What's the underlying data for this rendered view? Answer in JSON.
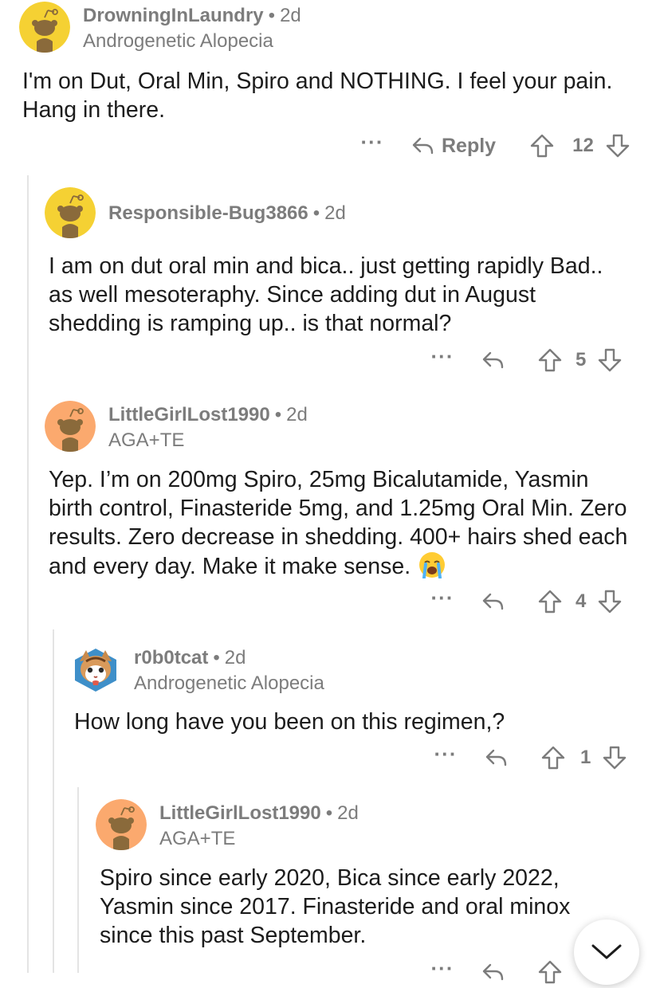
{
  "comments": [
    {
      "username": "DrowningInLaundry",
      "age": "2d",
      "flair": "Androgenetic Alopecia",
      "body": "I'm on Dut, Oral Min, Spiro and NOTHING. I feel your pain.  Hang in there.",
      "reply_label": "Reply",
      "score": "12",
      "avatar_color": "#f5d133"
    },
    {
      "username": "Responsible-Bug3866",
      "age": "2d",
      "body": "I am on dut oral min and bica.. just getting rapidly Bad.. as well mesoteraphy. Since adding dut in August shedding is ramping up.. is that normal?",
      "score": "5",
      "avatar_color": "#f5d133"
    },
    {
      "username": "LittleGirlLost1990",
      "age": "2d",
      "flair": "AGA+TE",
      "body": "Yep. I’m on 200mg Spiro, 25mg Bicalutamide, Yasmin birth control, Finasteride 5mg, and 1.25mg Oral Min. Zero results. Zero decrease in shedding. 400+ hairs shed each and every day. Make it make sense.",
      "score": "4",
      "avatar_color": "#fba96e"
    },
    {
      "username": "r0b0tcat",
      "age": "2d",
      "flair": "Androgenetic Alopecia",
      "body": "How long have you been on this regimen,?",
      "score": "1"
    },
    {
      "username": "LittleGirlLost1990",
      "age": "2d",
      "flair": "AGA+TE",
      "body": "Spiro since early 2020, Bica since early 2022, Yasmin since 2017. Finasteride and oral minox since this past September.",
      "avatar_color": "#fba96e"
    }
  ],
  "more_label": "···",
  "colors": {
    "meta_gray": "#7c7c7c",
    "thread_line": "#e4e4e4",
    "text": "#1c1c1c"
  },
  "icons": [
    "reply-arrow-icon",
    "upvote-icon",
    "downvote-icon",
    "more-options-icon",
    "crying-emoji-icon",
    "chevron-down-icon"
  ]
}
